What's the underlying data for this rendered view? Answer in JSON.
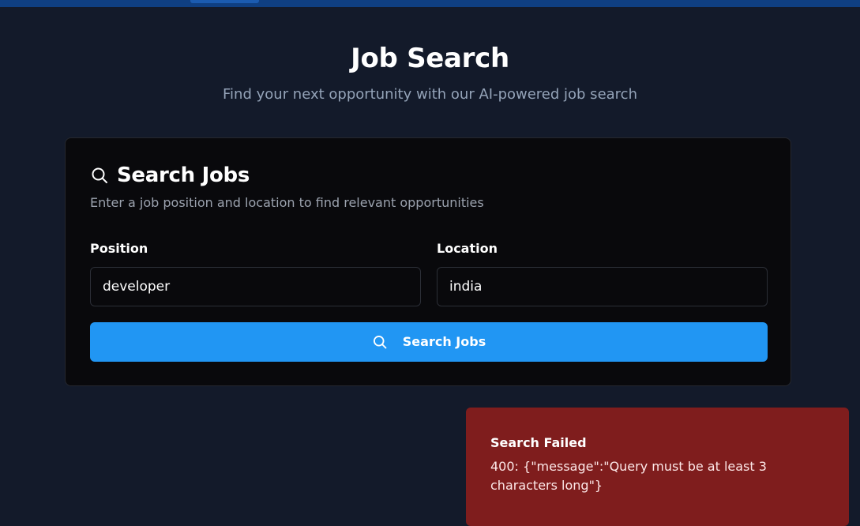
{
  "page": {
    "title": "Job Search",
    "subtitle": "Find your next opportunity with our AI-powered job search"
  },
  "search_card": {
    "icon": "search-icon",
    "title": "Search Jobs",
    "description": "Enter a job position and location to find relevant opportunities",
    "position_label": "Position",
    "position_value": "developer",
    "location_label": "Location",
    "location_value": "india",
    "button_icon": "search-icon",
    "button_label": "Search Jobs"
  },
  "toast": {
    "title": "Search Failed",
    "message": "400: {\"message\":\"Query must be at least 3 characters long\"}"
  },
  "colors": {
    "background": "#131a2a",
    "topbar": "#0f3f82",
    "card": "#09090c",
    "accent": "#2196f3",
    "error": "#7f1d1d"
  }
}
